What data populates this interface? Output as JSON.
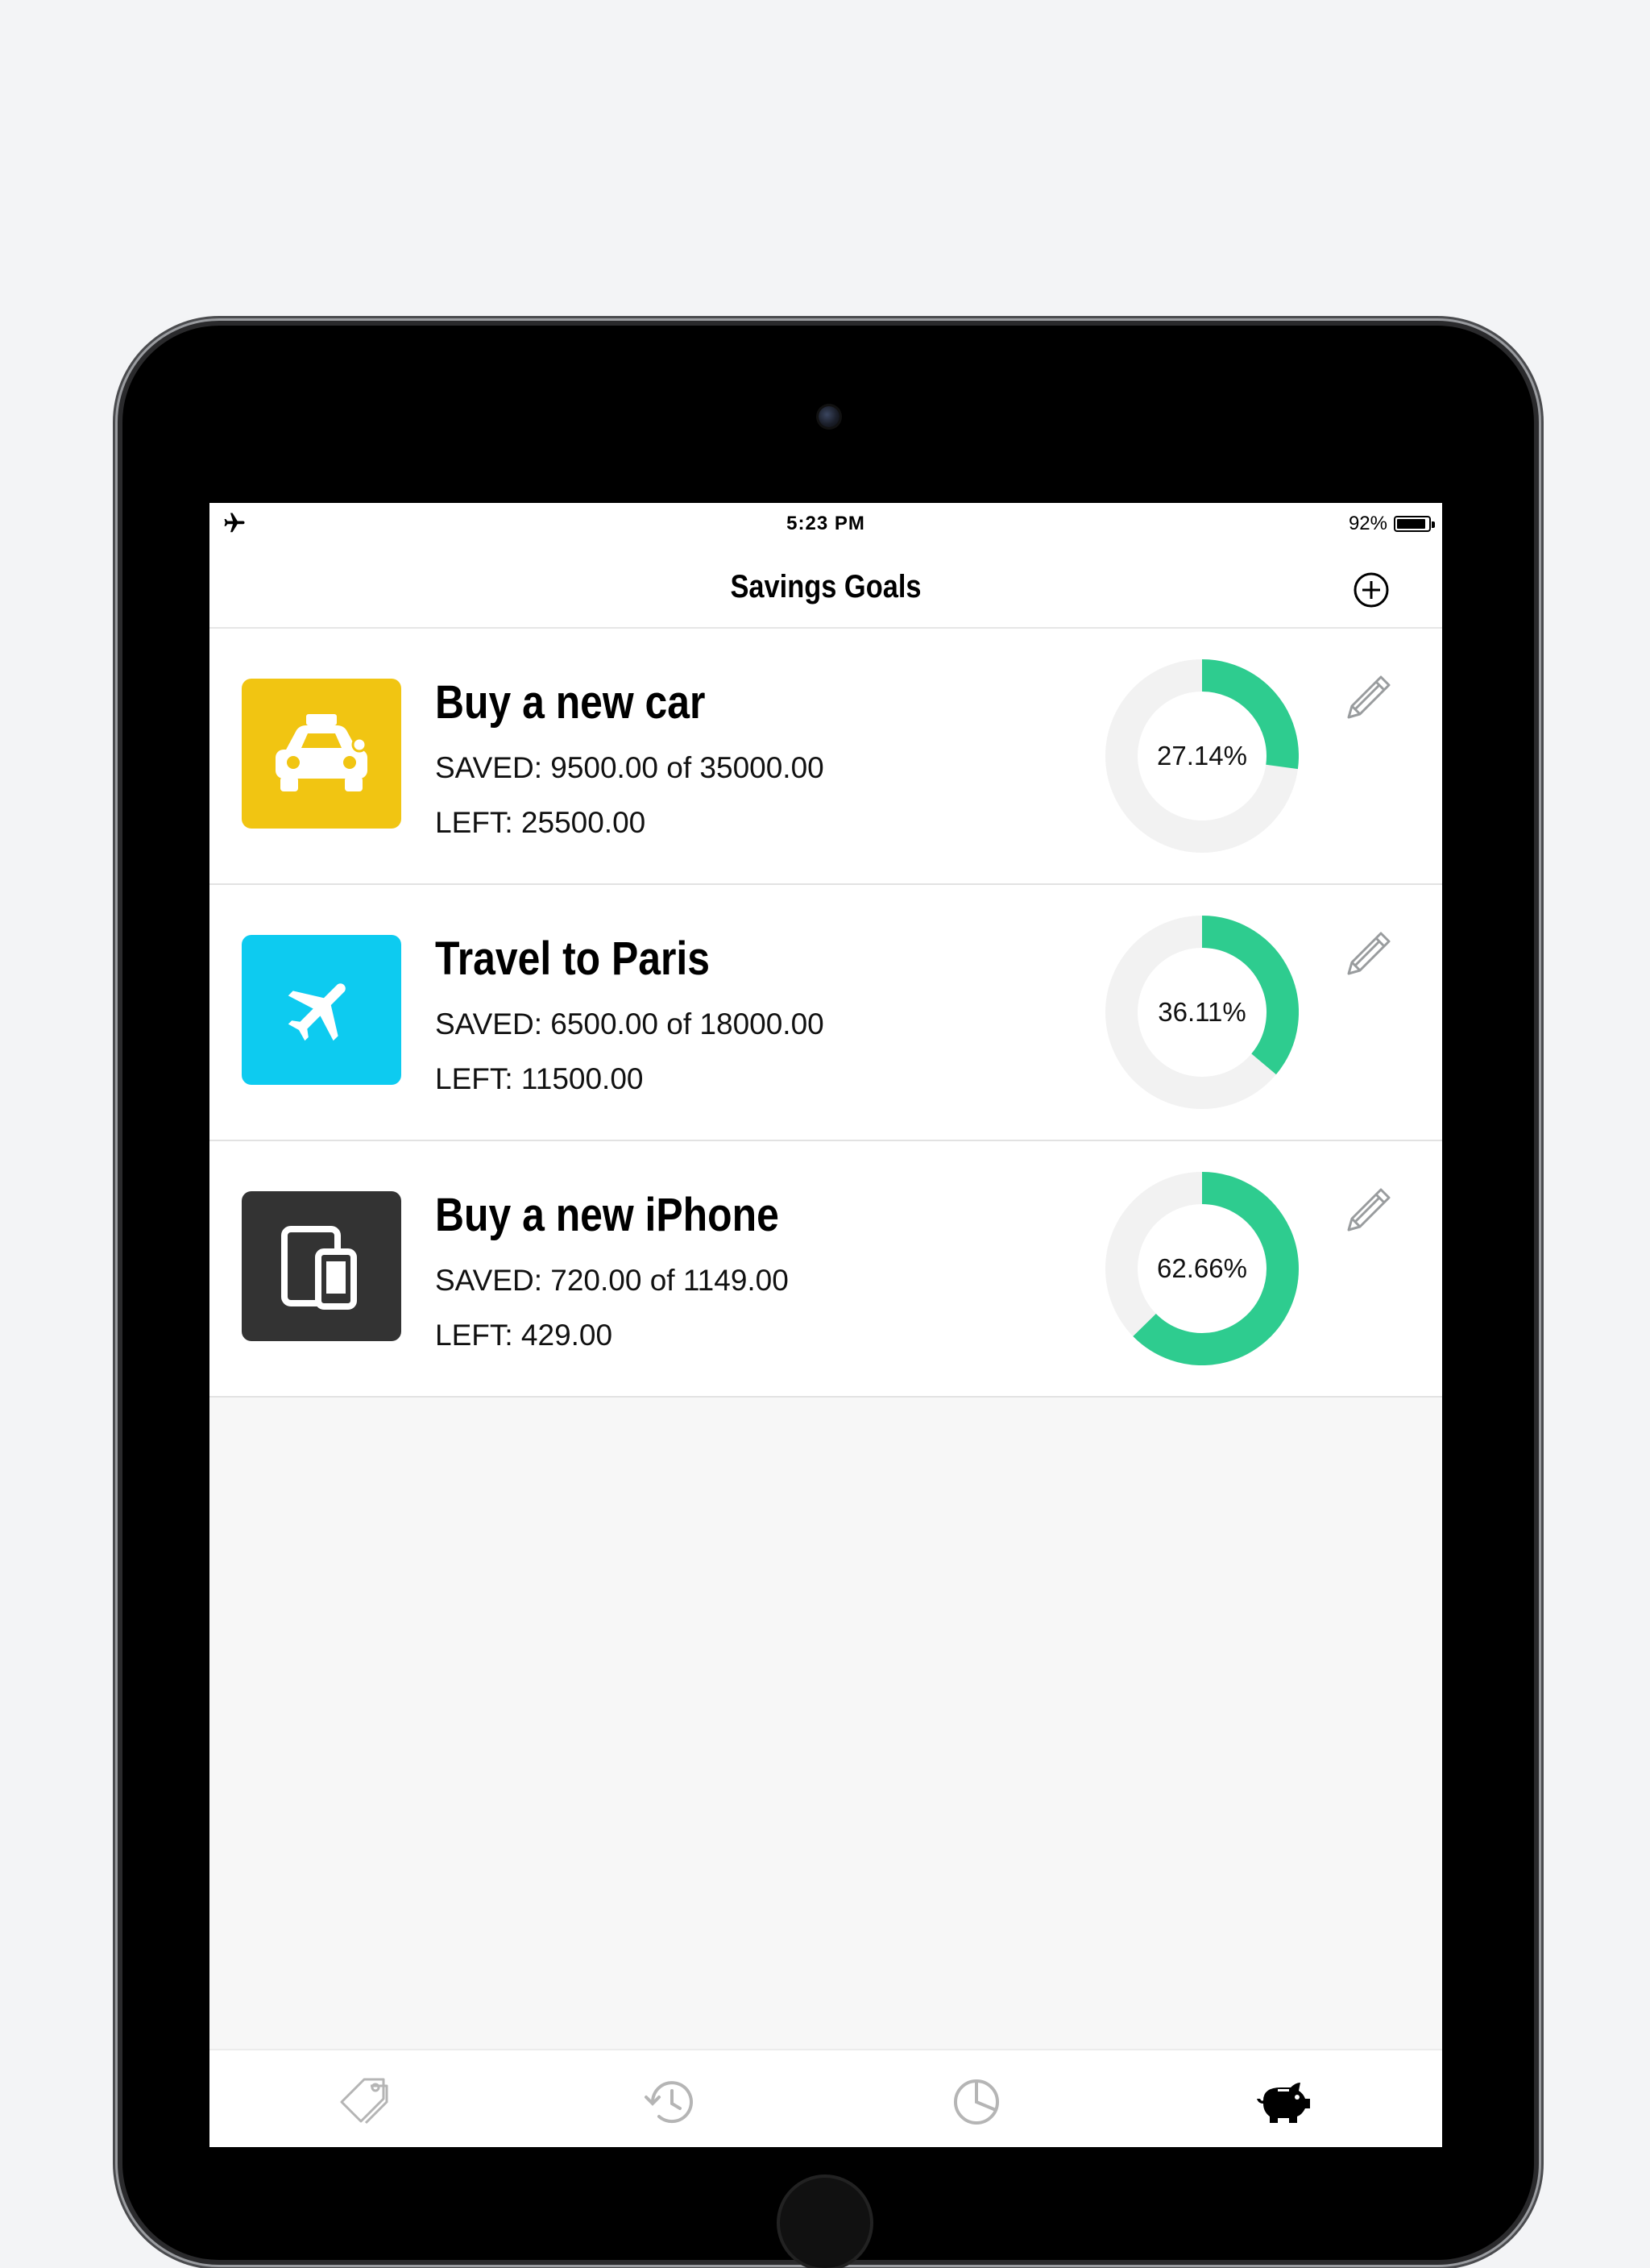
{
  "status_bar": {
    "time": "5:23 PM",
    "battery_text": "92%",
    "battery_level": 0.92,
    "left_icon": "airplane-mode-icon"
  },
  "header": {
    "title": "Savings Goals",
    "add_icon": "plus-circle-icon"
  },
  "colors": {
    "accent": "#2ecc8f",
    "track": "#f2f2f2",
    "car_icon_bg": "#f1c512",
    "travel_icon_bg": "#0dcbf0",
    "iphone_icon_bg": "#333333"
  },
  "goals": [
    {
      "title": "Buy a new car",
      "saved_text": "SAVED: 9500.00 of 35000.00",
      "left_text": "LEFT: 25500.00",
      "percent_label": "27.14%",
      "progress": 0.2714,
      "icon": "taxi-icon",
      "icon_color": "#f1c512"
    },
    {
      "title": "Travel to Paris",
      "saved_text": "SAVED: 6500.00 of 18000.00",
      "left_text": "LEFT: 11500.00",
      "percent_label": "36.11%",
      "progress": 0.3611,
      "icon": "airplane-icon",
      "icon_color": "#0dcbf0"
    },
    {
      "title": "Buy a new iPhone",
      "saved_text": "SAVED: 720.00 of 1149.00",
      "left_text": "LEFT: 429.00",
      "percent_label": "62.66%",
      "progress": 0.6266,
      "icon": "devices-icon",
      "icon_color": "#333333"
    }
  ],
  "tab_bar": {
    "tabs": [
      {
        "icon": "tags-icon",
        "active": false
      },
      {
        "icon": "history-icon",
        "active": false
      },
      {
        "icon": "pie-chart-icon",
        "active": false
      },
      {
        "icon": "piggy-bank-icon",
        "active": true
      }
    ]
  }
}
